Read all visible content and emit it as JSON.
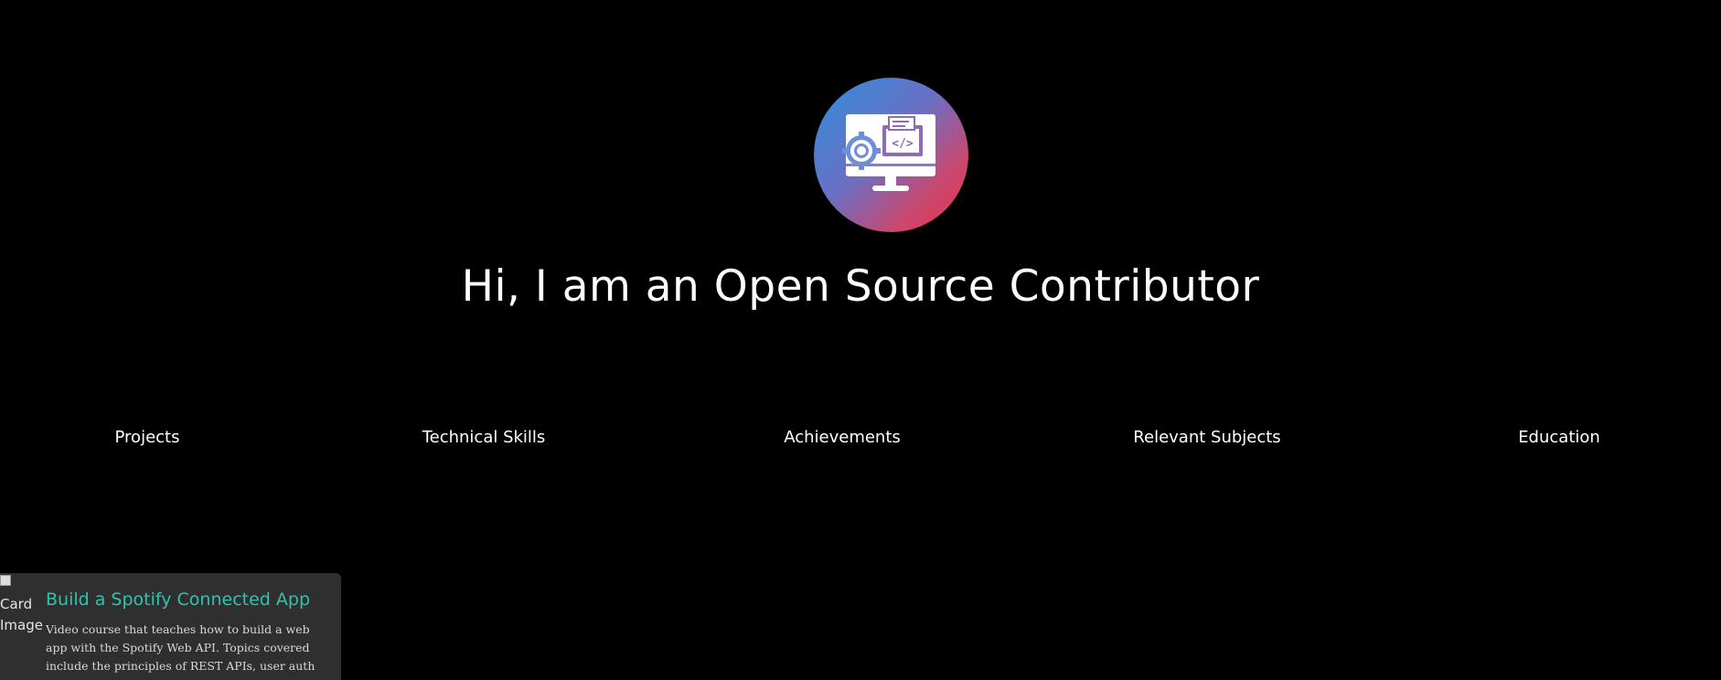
{
  "hero": {
    "logo_icon": "monitor-code-gear-icon",
    "title": "Hi, I am an Open Source Contributor"
  },
  "nav": {
    "items": [
      {
        "label": "Projects"
      },
      {
        "label": "Technical Skills"
      },
      {
        "label": "Achievements"
      },
      {
        "label": "Relevant Subjects"
      },
      {
        "label": "Education"
      }
    ]
  },
  "card": {
    "image_alt": "Card Image",
    "title": "Build a Spotify Connected App",
    "description": "Video course that teaches how to build a web app with the Spotify Web API. Topics covered include the principles of REST APIs, user auth flows, Node, Express, React, Styled Components, and more."
  },
  "colors": {
    "background": "#000000",
    "card_background": "#2f2f2f",
    "card_title": "#2ec4b0",
    "logo_gradient_start": "#2f8fdc",
    "logo_gradient_end": "#e8324e"
  }
}
